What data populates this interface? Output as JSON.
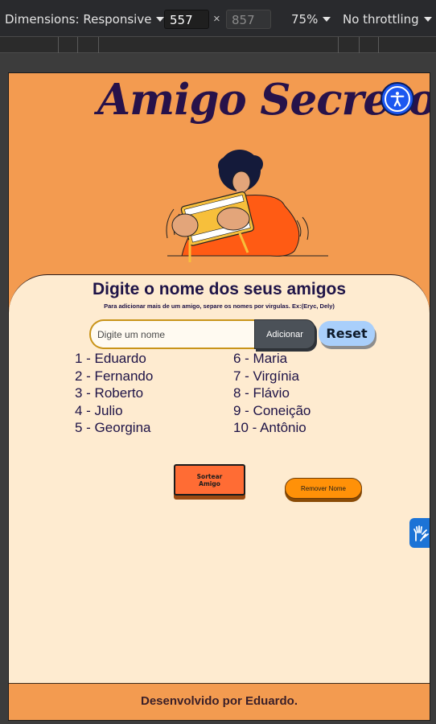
{
  "devtools": {
    "dimensions_label": "Dimensions: Responsive",
    "width": "557",
    "height": "857",
    "times": "×",
    "zoom": "75%",
    "throttle": "No throttling"
  },
  "app": {
    "title": "Amigo Secreto",
    "heading": "Digite o nome dos seus amigos",
    "hint": "Para adicionar mais de um amigo, separe os nomes por virgulas. Ex:(Eryc, Dely)",
    "input_placeholder": "Digite um nome",
    "add_label": "Adicionar",
    "reset_label": "Reset",
    "friends_col1": [
      "1 - Eduardo",
      "2 - Fernando",
      "3 - Roberto",
      "4 - Julio",
      "5 - Georgina"
    ],
    "friends_col2": [
      "6 - Maria",
      "7 - Virgínia",
      "8 - Flávio",
      "9 - Coneição",
      "10 - Antônio"
    ],
    "draw_label_line1": "Sortear",
    "draw_label_line2": "Amigo",
    "remove_label": "Remover Nome",
    "footer": "Desenvolvido por Eduardo."
  },
  "icons": {
    "accessibility": "accessibility-icon",
    "vlibras": "sign-language-hands-icon"
  },
  "colors": {
    "page_bg": "#f39b50",
    "card_bg": "#feebd0",
    "title": "#27124a",
    "draw_button": "#ff6c34",
    "remove_button": "#ff9108",
    "reset_button": "#a9cffb",
    "add_button": "#4b5158",
    "accessibility_button": "#1c57f0"
  }
}
